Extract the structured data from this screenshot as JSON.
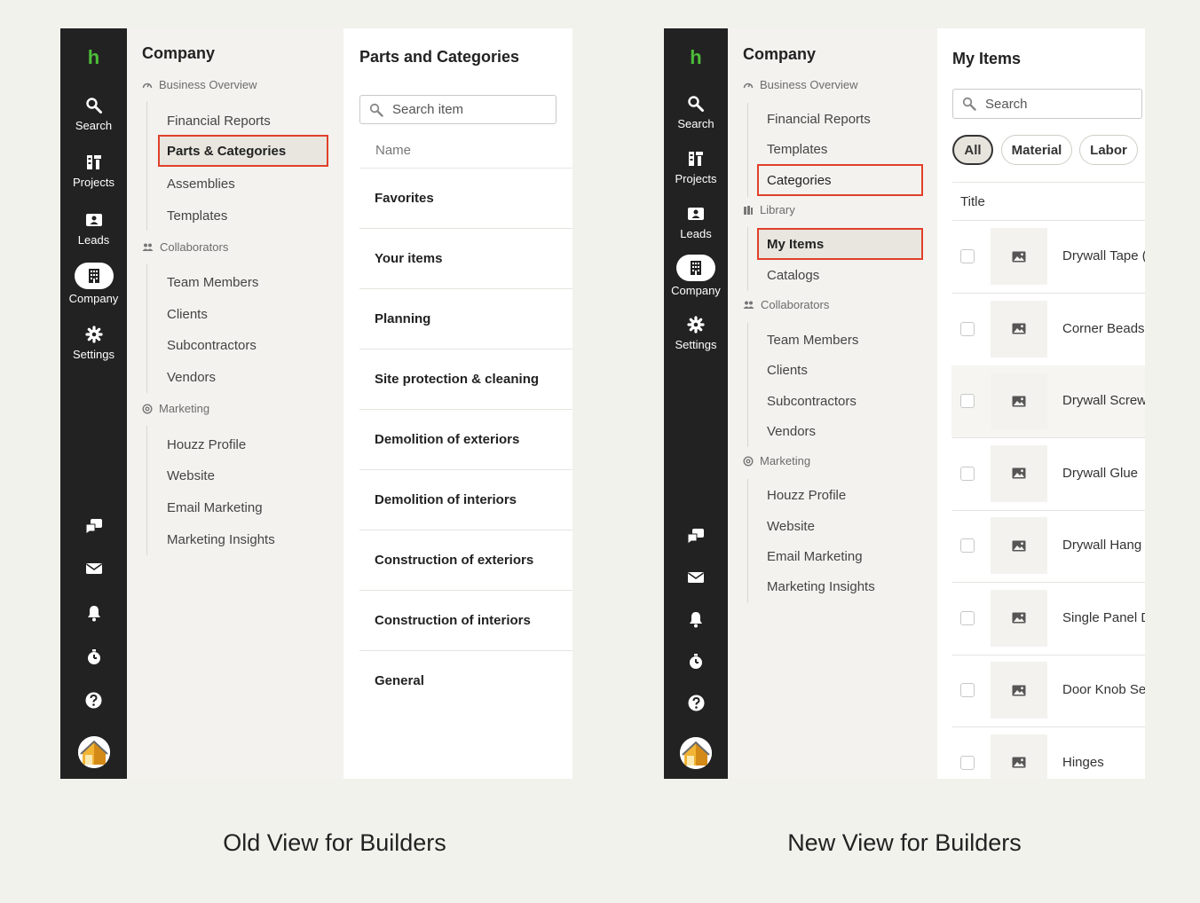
{
  "captions": {
    "old": "Old View for Builders",
    "new": "New View for Builders"
  },
  "colors": {
    "rail": "#222222",
    "logo": "#4dbd38",
    "highlight": "#e0402a",
    "nav_bg": "#f3f2ee",
    "page_bg": "#f2f2ed"
  },
  "old_view": {
    "rail": {
      "logo": "h",
      "items": [
        {
          "icon": "search-icon",
          "label": "Search"
        },
        {
          "icon": "projects-icon",
          "label": "Projects"
        },
        {
          "icon": "leads-icon",
          "label": "Leads"
        },
        {
          "icon": "company-icon",
          "label": "Company",
          "active": true
        },
        {
          "icon": "gear-icon",
          "label": "Settings"
        }
      ],
      "utility_icons": [
        "chat-icon",
        "inbox-icon",
        "bell-icon",
        "timer-icon",
        "help-icon"
      ],
      "avatar": "avatar"
    },
    "nav": {
      "title": "Company",
      "sections": [
        {
          "label": "Business Overview",
          "items": [
            "Financial Reports",
            "Parts & Categories",
            "Assemblies",
            "Templates"
          ],
          "selected": "Parts & Categories"
        },
        {
          "label": "Collaborators",
          "items": [
            "Team Members",
            "Clients",
            "Subcontractors",
            "Vendors"
          ]
        },
        {
          "label": "Marketing",
          "items": [
            "Houzz Profile",
            "Website",
            "Email Marketing",
            "Marketing Insights"
          ]
        }
      ]
    },
    "content": {
      "title": "Parts and Categories",
      "search_placeholder": "Search item",
      "column_header": "Name",
      "categories": [
        "Favorites",
        "Your items",
        "Planning",
        "Site protection & cleaning",
        "Demolition of exteriors",
        "Demolition of interiors",
        "Construction of exteriors",
        "Construction of interiors",
        "General"
      ]
    }
  },
  "new_view": {
    "rail": {
      "logo": "h",
      "items": [
        {
          "icon": "search-icon",
          "label": "Search"
        },
        {
          "icon": "projects-icon",
          "label": "Projects"
        },
        {
          "icon": "leads-icon",
          "label": "Leads"
        },
        {
          "icon": "company-icon",
          "label": "Company",
          "active": true
        },
        {
          "icon": "gear-icon",
          "label": "Settings"
        }
      ],
      "utility_icons": [
        "chat-icon",
        "inbox-icon",
        "bell-icon",
        "timer-icon",
        "help-icon"
      ],
      "avatar": "avatar"
    },
    "nav": {
      "title": "Company",
      "sections": [
        {
          "label": "Business Overview",
          "items": [
            "Financial Reports",
            "Templates",
            "Categories"
          ],
          "boxed": "Categories"
        },
        {
          "label": "Library",
          "items": [
            "My Items",
            "Catalogs"
          ],
          "selected": "My Items"
        },
        {
          "label": "Collaborators",
          "items": [
            "Team Members",
            "Clients",
            "Subcontractors",
            "Vendors"
          ]
        },
        {
          "label": "Marketing",
          "items": [
            "Houzz Profile",
            "Website",
            "Email Marketing",
            "Marketing Insights"
          ]
        }
      ]
    },
    "content": {
      "title": "My Items",
      "search_placeholder": "Search",
      "filters": [
        "All",
        "Material",
        "Labor"
      ],
      "active_filter": "All",
      "column_header": "Title",
      "items": [
        "Drywall Tape (",
        "Corner Beads",
        "Drywall Screw",
        "Drywall Glue",
        "Drywall Hang",
        "Single Panel D",
        "Door Knob Se",
        "Hinges"
      ]
    }
  }
}
